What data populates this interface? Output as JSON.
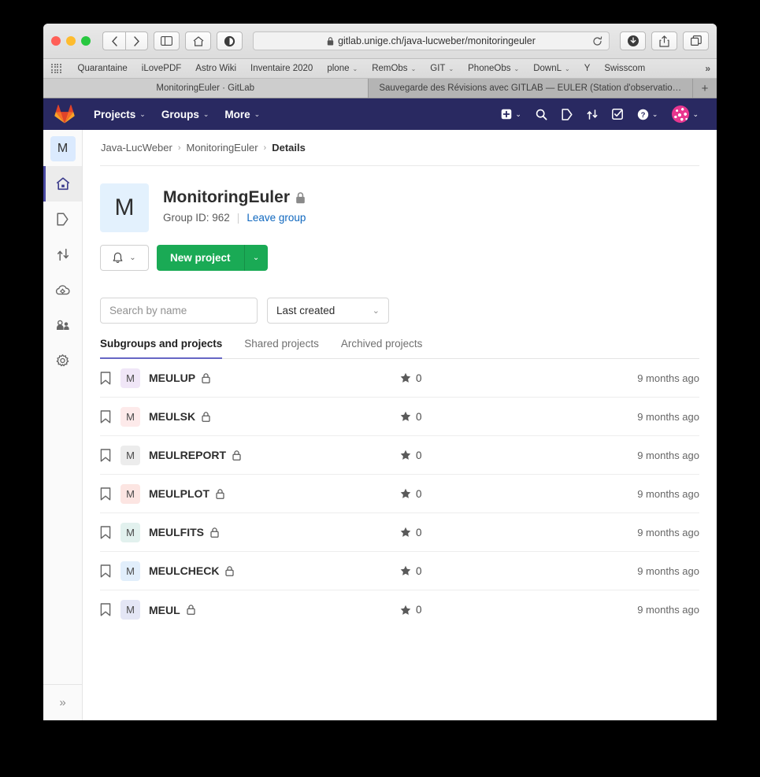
{
  "browser": {
    "url": "gitlab.unige.ch/java-lucweber/monitoringeuler",
    "lock_icon": "lock-icon",
    "reload_icon": "reload-icon",
    "back_icon": "back-chevron-icon",
    "forward_icon": "forward-chevron-icon",
    "sidebar_icon": "sidebar-toggle-icon",
    "home_icon": "home-icon",
    "shield_icon": "privacy-shield-icon",
    "download_icon": "download-icon",
    "share_icon": "share-icon",
    "tabs_icon": "show-tabs-icon",
    "bookmarks": [
      {
        "label": "Quarantaine",
        "dropdown": false
      },
      {
        "label": "iLovePDF",
        "dropdown": false
      },
      {
        "label": "Astro Wiki",
        "dropdown": false
      },
      {
        "label": "Inventaire 2020",
        "dropdown": false
      },
      {
        "label": "plone",
        "dropdown": true
      },
      {
        "label": "RemObs",
        "dropdown": true
      },
      {
        "label": "GIT",
        "dropdown": true
      },
      {
        "label": "PhoneObs",
        "dropdown": true
      },
      {
        "label": "DownL",
        "dropdown": true
      },
      {
        "label": "Y",
        "dropdown": false
      },
      {
        "label": "Swisscom",
        "dropdown": false
      }
    ],
    "bookmarks_overflow": "»",
    "tabs": [
      {
        "title": "MonitoringEuler · GitLab",
        "active": true
      },
      {
        "title": "Sauvegarde des Révisions avec GITLAB — EULER (Station d'observatio…",
        "active": false
      }
    ],
    "new_tab_label": "+"
  },
  "navbar": {
    "brand": "gitlab-logo",
    "items": [
      {
        "label": "Projects",
        "caret": "⌄"
      },
      {
        "label": "Groups",
        "caret": "⌄"
      },
      {
        "label": "More",
        "caret": "⌄"
      }
    ],
    "right_icons": [
      {
        "name": "new-dropdown-icon",
        "caret": true
      },
      {
        "name": "search-icon",
        "caret": false
      },
      {
        "name": "issues-icon",
        "caret": false
      },
      {
        "name": "merge-requests-icon",
        "caret": false
      },
      {
        "name": "todos-icon",
        "caret": false
      },
      {
        "name": "help-icon",
        "caret": true
      },
      {
        "name": "user-avatar",
        "caret": true
      }
    ]
  },
  "sidebar": {
    "avatar_letter": "M",
    "items": [
      {
        "name": "sidebar-item-home",
        "icon": "home-icon",
        "active": true
      },
      {
        "name": "sidebar-item-issues",
        "icon": "issues-icon",
        "active": false
      },
      {
        "name": "sidebar-item-merge-requests",
        "icon": "merge-requests-icon",
        "active": false
      },
      {
        "name": "sidebar-item-kubernetes",
        "icon": "kubernetes-icon",
        "active": false
      },
      {
        "name": "sidebar-item-members",
        "icon": "members-icon",
        "active": false
      },
      {
        "name": "sidebar-item-settings",
        "icon": "gear-icon",
        "active": false
      }
    ],
    "collapse_icon": "»"
  },
  "breadcrumb": {
    "items": [
      "Java-LucWeber",
      "MonitoringEuler",
      "Details"
    ],
    "separator": "›"
  },
  "group": {
    "avatar_letter": "M",
    "name": "MonitoringEuler",
    "visibility_icon": "lock-icon",
    "group_id_label": "Group ID: 962",
    "divider": "|",
    "leave_link": "Leave group",
    "notification_icon": "bell-icon",
    "notification_caret": "⌄",
    "new_project_label": "New project",
    "new_project_caret": "⌄"
  },
  "filters": {
    "search_placeholder": "Search by name",
    "search_value": "",
    "sort_selected": "Last created",
    "sort_caret": "⌄"
  },
  "tabs": [
    {
      "label": "Subgroups and projects",
      "active": true
    },
    {
      "label": "Shared projects",
      "active": false
    },
    {
      "label": "Archived projects",
      "active": false
    }
  ],
  "projects": [
    {
      "name": "MEULUP",
      "avatar_letter": "M",
      "avatar_color": "#f0e6f7",
      "stars": "0",
      "updated": "9 months ago",
      "visibility": "lock-icon"
    },
    {
      "name": "MEULSK",
      "avatar_letter": "M",
      "avatar_color": "#fdeaea",
      "stars": "0",
      "updated": "9 months ago",
      "visibility": "lock-icon"
    },
    {
      "name": "MEULREPORT",
      "avatar_letter": "M",
      "avatar_color": "#ececec",
      "stars": "0",
      "updated": "9 months ago",
      "visibility": "lock-icon"
    },
    {
      "name": "MEULPLOT",
      "avatar_letter": "M",
      "avatar_color": "#fce5e2",
      "stars": "0",
      "updated": "9 months ago",
      "visibility": "lock-icon"
    },
    {
      "name": "MEULFITS",
      "avatar_letter": "M",
      "avatar_color": "#e2f1ee",
      "stars": "0",
      "updated": "9 months ago",
      "visibility": "lock-icon"
    },
    {
      "name": "MEULCHECK",
      "avatar_letter": "M",
      "avatar_color": "#e1eefb",
      "stars": "0",
      "updated": "9 months ago",
      "visibility": "lock-icon"
    },
    {
      "name": "MEUL",
      "avatar_letter": "M",
      "avatar_color": "#e4e6f5",
      "stars": "0",
      "updated": "9 months ago",
      "visibility": "lock-icon"
    }
  ],
  "colors": {
    "navbar_bg": "#292961",
    "accent": "#6666c4",
    "green": "#1aaa55",
    "link": "#1068bf"
  }
}
